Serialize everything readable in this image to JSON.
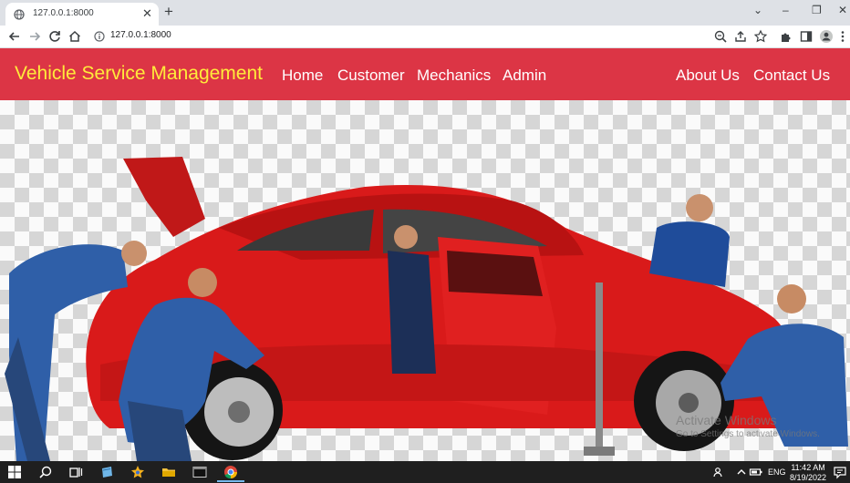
{
  "browser": {
    "tab_title": "127.0.0.1:8000",
    "tab_close": "✕",
    "new_tab": "+",
    "url": "127.0.0.1:8000",
    "window_controls": [
      "⌄",
      "–",
      "❐",
      "✕"
    ]
  },
  "navbar": {
    "brand": "Vehicle Service Management",
    "links": [
      "Home",
      "Customer",
      "Mechanics",
      "Admin"
    ],
    "right_links": [
      "About Us",
      "Contact Us"
    ]
  },
  "hero": {
    "watermark_line1": "Activate Windows",
    "watermark_line2": "Go to Settings to activate Windows."
  },
  "taskbar": {
    "language": "ENG",
    "time": "11:42 AM",
    "date": "8/19/2022"
  },
  "colors": {
    "navbar_bg": "#dc3545",
    "brand": "#ffeb3b",
    "car_red": "#d91a1a",
    "mechanic_blue": "#2f5fa8"
  }
}
